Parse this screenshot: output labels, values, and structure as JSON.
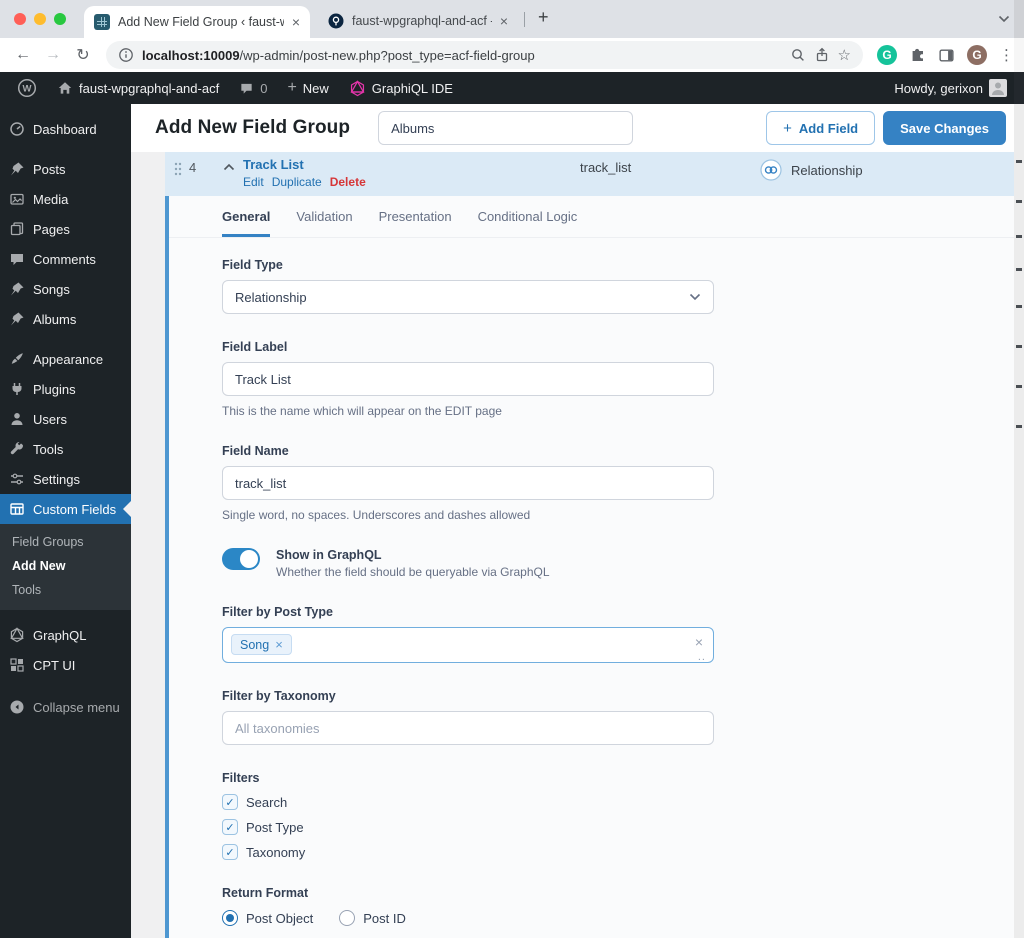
{
  "icons": {
    "close": "×",
    "new_tab": "+",
    "back": "←",
    "forward": "→",
    "reload": "↻",
    "more": "⋮",
    "star": "☆",
    "check": "✓",
    "plus": "+",
    "grip": "..",
    "tag_close": "×",
    "clear": "×"
  },
  "browser": {
    "tabs": [
      {
        "title": "Add New Field Group ‹ faust-w"
      },
      {
        "title": "faust-wpgraphql-and-acf -"
      }
    ],
    "url_host": "localhost:10009",
    "url_path": "/wp-admin/post-new.php?post_type=acf-field-group",
    "grammarly_letter": "G",
    "avatar_letter": "G"
  },
  "admin_bar": {
    "site": "faust-wpgraphql-and-acf",
    "comments": "0",
    "new_label": "New",
    "graphiql": "GraphiQL IDE",
    "howdy": "Howdy, gerixon"
  },
  "sidebar": {
    "items": [
      {
        "label": "Dashboard"
      },
      {
        "label": "Posts"
      },
      {
        "label": "Media"
      },
      {
        "label": "Pages"
      },
      {
        "label": "Comments"
      },
      {
        "label": "Songs"
      },
      {
        "label": "Albums"
      },
      {
        "label": "Appearance"
      },
      {
        "label": "Plugins"
      },
      {
        "label": "Users"
      },
      {
        "label": "Tools"
      },
      {
        "label": "Settings"
      },
      {
        "label": "Custom Fields"
      }
    ],
    "submenu": [
      "Field Groups",
      "Add New",
      "Tools"
    ],
    "plugin_items": [
      "GraphQL",
      "CPT UI"
    ],
    "collapse": "Collapse menu"
  },
  "header": {
    "title": "Add New Field Group",
    "title_value": "Albums",
    "add_field": "Add Field",
    "save": "Save Changes"
  },
  "field_row": {
    "order": "4",
    "title": "Track List",
    "edit": "Edit",
    "duplicate": "Duplicate",
    "delete": "Delete",
    "name": "track_list",
    "type": "Relationship"
  },
  "tabs": {
    "items": [
      "General",
      "Validation",
      "Presentation",
      "Conditional Logic"
    ]
  },
  "settings": {
    "field_type": {
      "label": "Field Type",
      "value": "Relationship"
    },
    "field_label": {
      "label": "Field Label",
      "value": "Track List",
      "hint": "This is the name which will appear on the EDIT page"
    },
    "field_name": {
      "label": "Field Name",
      "value": "track_list",
      "hint": "Single word, no spaces. Underscores and dashes allowed"
    },
    "graphql": {
      "label": "Show in GraphQL",
      "hint": "Whether the field should be queryable via GraphQL",
      "on": true
    },
    "post_type": {
      "label": "Filter by Post Type",
      "tag": "Song"
    },
    "taxonomy": {
      "label": "Filter by Taxonomy",
      "placeholder": "All taxonomies"
    },
    "filters": {
      "label": "Filters",
      "options": [
        "Search",
        "Post Type",
        "Taxonomy"
      ]
    },
    "return_format": {
      "label": "Return Format",
      "options": [
        "Post Object",
        "Post ID"
      ],
      "selected": "Post Object"
    }
  },
  "colors": {
    "accent": "#2271b1",
    "save_button": "#3582c4",
    "delete": "#d63638",
    "field_row_bg": "#dbeaf6",
    "panel_border": "#4e97d1",
    "toggle_on": "#2b87c6",
    "admin_dark": "#1d2327",
    "graphiql_pink": "#e535ab"
  }
}
